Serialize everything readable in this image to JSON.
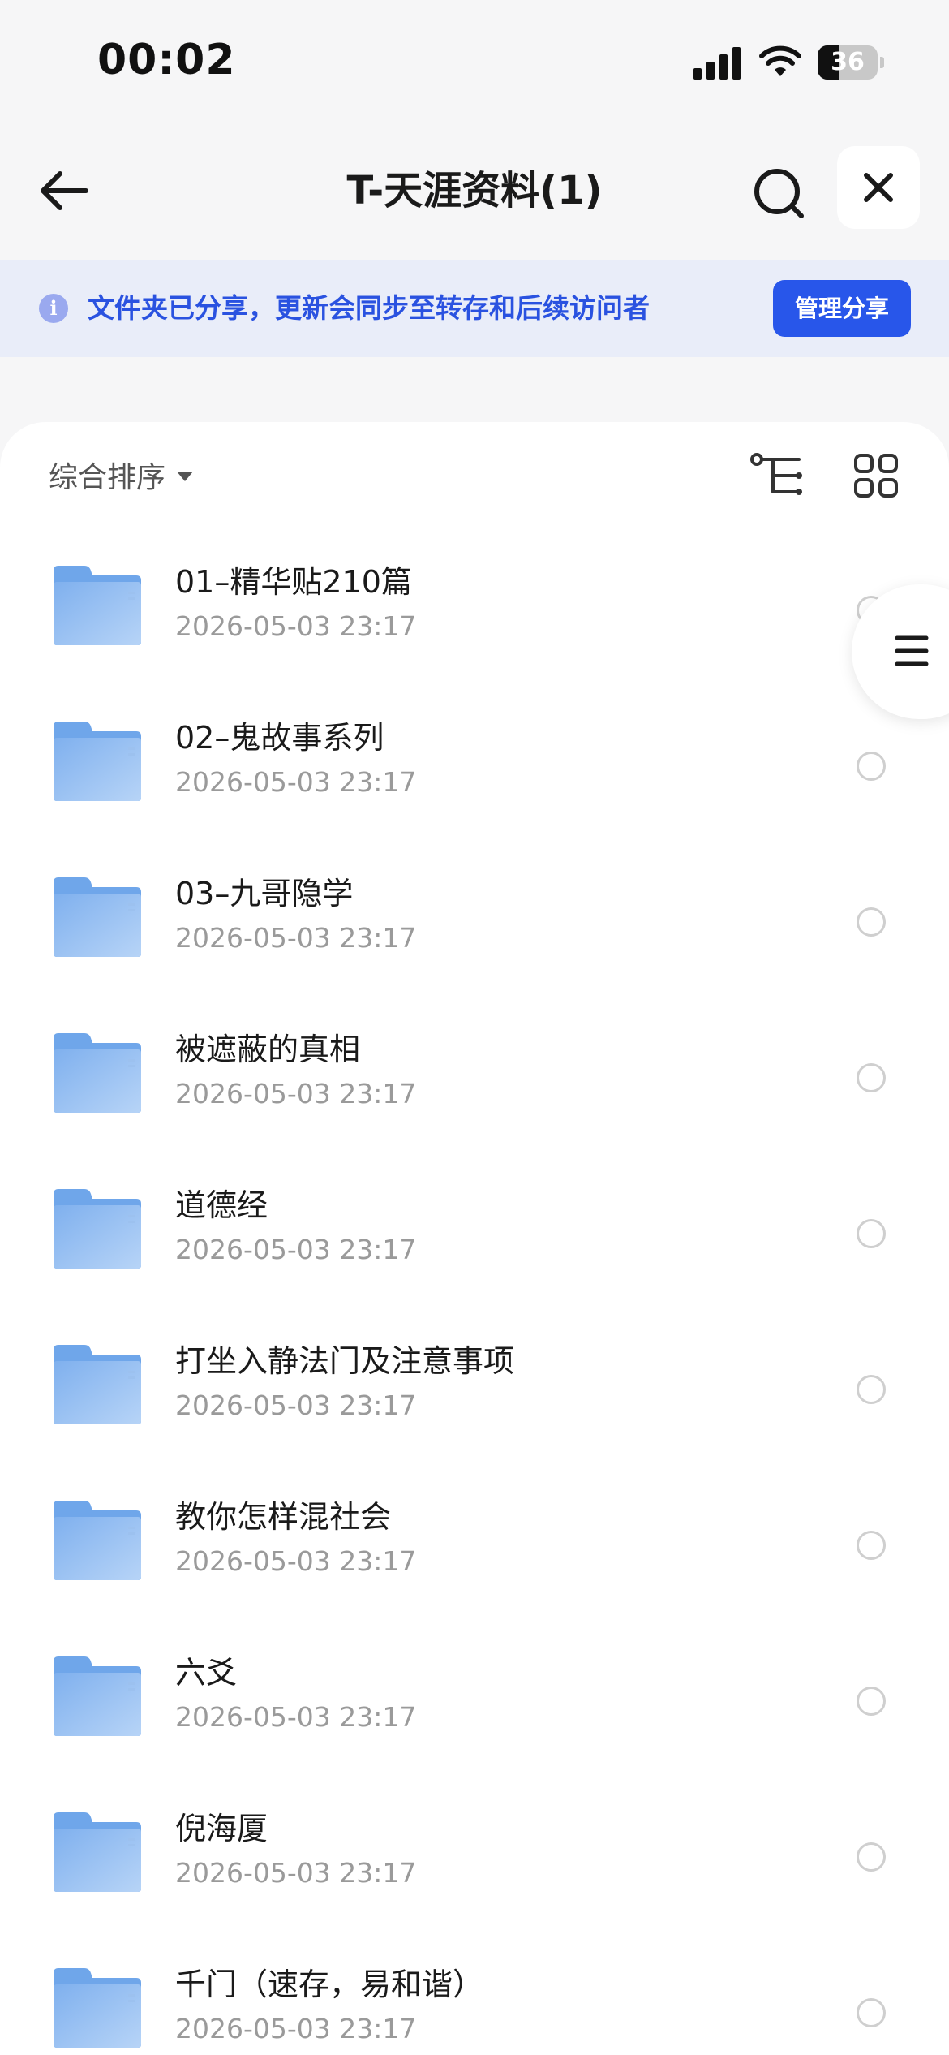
{
  "status_bar": {
    "time": "00:02",
    "battery_level": "36",
    "battery_fraction": 0.36
  },
  "nav": {
    "title": "T-天涯资料(1)",
    "back_icon": "arrow-left-icon",
    "search_icon": "search-icon",
    "close_icon": "close-icon"
  },
  "share_banner": {
    "info_icon": "info-icon",
    "text": "文件夹已分享，更新会同步至转存和后续访问者",
    "button_label": "管理分享"
  },
  "toolbar": {
    "sort_label": "综合排序",
    "tree_icon": "tree-view-icon",
    "grid_icon": "grid-view-icon"
  },
  "files": [
    {
      "name": "01–精华贴210篇",
      "date": "2026-05-03 23:17"
    },
    {
      "name": "02–鬼故事系列",
      "date": "2026-05-03 23:17"
    },
    {
      "name": "03–九哥隐学",
      "date": "2026-05-03 23:17"
    },
    {
      "name": "被遮蔽的真相",
      "date": "2026-05-03 23:17"
    },
    {
      "name": "道德经",
      "date": "2026-05-03 23:17"
    },
    {
      "name": "打坐入静法门及注意事项",
      "date": "2026-05-03 23:17"
    },
    {
      "name": "教你怎样混社会",
      "date": "2026-05-03 23:17"
    },
    {
      "name": "六爻",
      "date": "2026-05-03 23:17"
    },
    {
      "name": "倪海厦",
      "date": "2026-05-03 23:17"
    },
    {
      "name": "千门（速存，易和谐）",
      "date": "2026-05-03 23:17"
    }
  ],
  "colors": {
    "accent": "#2856ea",
    "banner_bg": "#e9edf9",
    "banner_text": "#2a52e0",
    "folder": "#7eb2f0"
  }
}
